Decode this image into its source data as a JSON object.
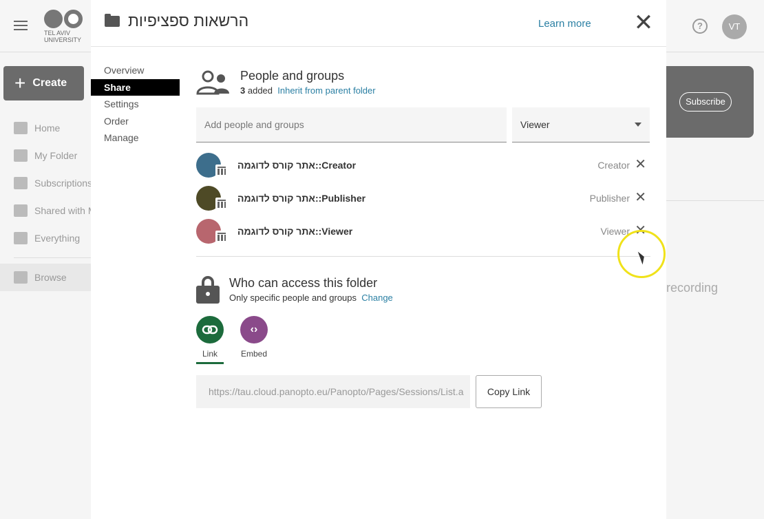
{
  "app": {
    "logo_text": "TEL AVIV UNIVERSITY",
    "avatar_initials": "VT",
    "create_label": "Create",
    "nav": [
      {
        "label": "Home"
      },
      {
        "label": "My Folder"
      },
      {
        "label": "Subscriptions"
      },
      {
        "label": "Shared with Me"
      },
      {
        "label": "Everything"
      },
      {
        "label": "Browse"
      }
    ],
    "subscribe_label": "Subscribe",
    "recording_text": "recording"
  },
  "modal": {
    "title": "הרשאות ספציפיות",
    "learn_more": "Learn more",
    "close": "✕",
    "tabs": [
      {
        "label": "Overview"
      },
      {
        "label": "Share"
      },
      {
        "label": "Settings"
      },
      {
        "label": "Order"
      },
      {
        "label": "Manage"
      }
    ],
    "people": {
      "title": "People and groups",
      "added_count": "3",
      "added_label": "added",
      "inherit_link": "Inherit from parent folder",
      "add_placeholder": "Add people and groups",
      "role_value": "Viewer",
      "members": [
        {
          "name": "אתר קורס לדוגמה::Creator",
          "role": "Creator",
          "color": "#3d6e8c"
        },
        {
          "name": "אתר קורס לדוגמה::Publisher",
          "role": "Publisher",
          "color": "#4e4a26"
        },
        {
          "name": "אתר קורס לדוגמה::Viewer",
          "role": "Viewer",
          "color": "#b8666e"
        }
      ]
    },
    "access": {
      "title": "Who can access this folder",
      "subtitle": "Only specific people and groups",
      "change_link": "Change"
    },
    "share_options": [
      {
        "label": "Link",
        "icon": "link-icon",
        "glyph": "⊖"
      },
      {
        "label": "Embed",
        "icon": "embed-icon",
        "glyph": "‹›"
      }
    ],
    "link_value": "https://tau.cloud.panopto.eu/Panopto/Pages/Sessions/List.a",
    "copy_label": "Copy Link"
  }
}
